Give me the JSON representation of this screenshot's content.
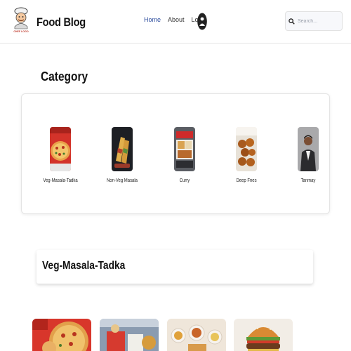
{
  "header": {
    "brand": "Food Blog",
    "logo_text": "CHEF LOGO",
    "nav": [
      "Home",
      "About",
      "Login"
    ],
    "search_placeholder": "Search..."
  },
  "category": {
    "title": "Category",
    "items": [
      {
        "label": "Veg-Masala-Tadka",
        "icon": "pizza-thumbnail"
      },
      {
        "label": "Non-Veg Masala",
        "icon": "wrap-thumbnail"
      },
      {
        "label": "Curry",
        "icon": "curry-box-thumbnail"
      },
      {
        "label": "Deep Fries",
        "icon": "fried-chicken-thumbnail"
      },
      {
        "label": "Tanmay",
        "icon": "person-thumbnail"
      }
    ]
  },
  "selected": {
    "title": "Veg-Masala-Tadka"
  },
  "colors": {
    "accent": "#2f4f9f",
    "border": "#e4e4e4",
    "text": "#111111"
  }
}
